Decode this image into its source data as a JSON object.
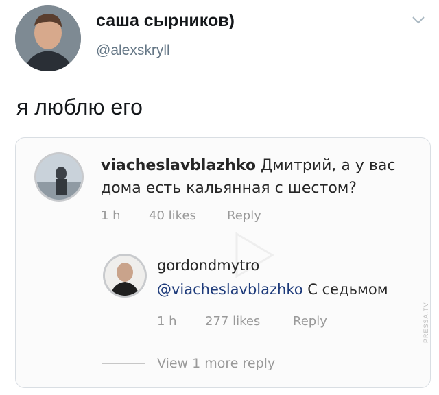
{
  "tweet": {
    "display_name": "саша сырников)",
    "handle": "@alexskryll",
    "text": "я люблю его",
    "menu_icon": "chevron-down-icon"
  },
  "embed": {
    "comment1": {
      "username": "viacheslavblazhko",
      "text": "Дмитрий, а у вас дома есть кальянная с шестом?",
      "time": "1 h",
      "likes": "40 likes",
      "reply": "Reply"
    },
    "comment2": {
      "username": "gordondmytro",
      "mention": "@viacheslavblazhko",
      "text": "С седьмом",
      "time": "1 h",
      "likes": "277 likes",
      "reply": "Reply"
    },
    "view_more": "View 1 more reply"
  },
  "watermark": "PRESSA.TV",
  "colors": {
    "name": "#14171a",
    "handle": "#657786",
    "meta": "#999999",
    "mention": "#1d3a7a"
  }
}
